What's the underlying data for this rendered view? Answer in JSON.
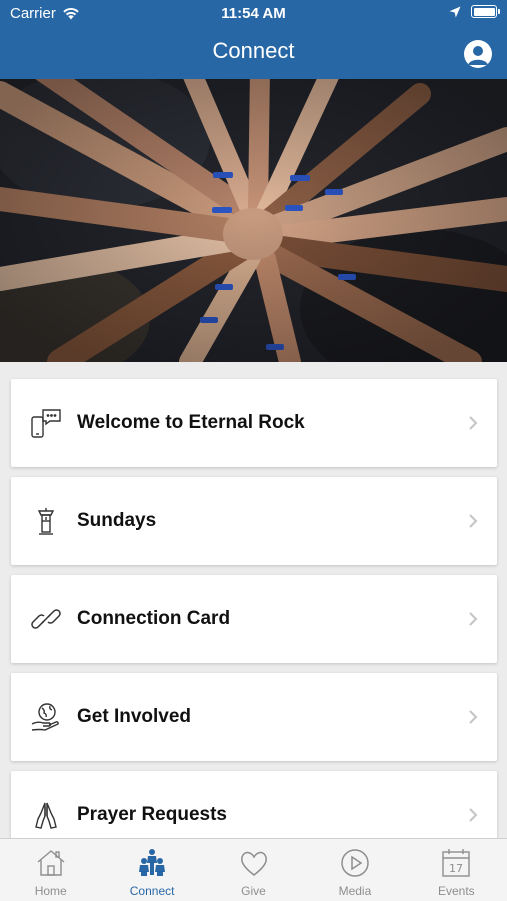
{
  "status_bar": {
    "carrier": "Carrier",
    "time": "11:54 AM"
  },
  "header": {
    "title": "Connect"
  },
  "menu_items": [
    {
      "label": "Welcome to Eternal Rock",
      "icon": "chat-phone-icon"
    },
    {
      "label": "Sundays",
      "icon": "pulpit-icon"
    },
    {
      "label": "Connection Card",
      "icon": "link-icon"
    },
    {
      "label": "Get Involved",
      "icon": "hand-globe-icon"
    },
    {
      "label": "Prayer Requests",
      "icon": "praying-hands-icon"
    }
  ],
  "tabs": [
    {
      "label": "Home",
      "icon": "home-icon",
      "active": false
    },
    {
      "label": "Connect",
      "icon": "people-icon",
      "active": true
    },
    {
      "label": "Give",
      "icon": "heart-icon",
      "active": false
    },
    {
      "label": "Media",
      "icon": "play-icon",
      "active": false
    },
    {
      "label": "Events",
      "icon": "calendar-icon",
      "active": false
    }
  ],
  "calendar_day": "17",
  "colors": {
    "header": "#2867a5",
    "active_tab": "#2867a5",
    "inactive_tab": "#8e8e8e"
  }
}
